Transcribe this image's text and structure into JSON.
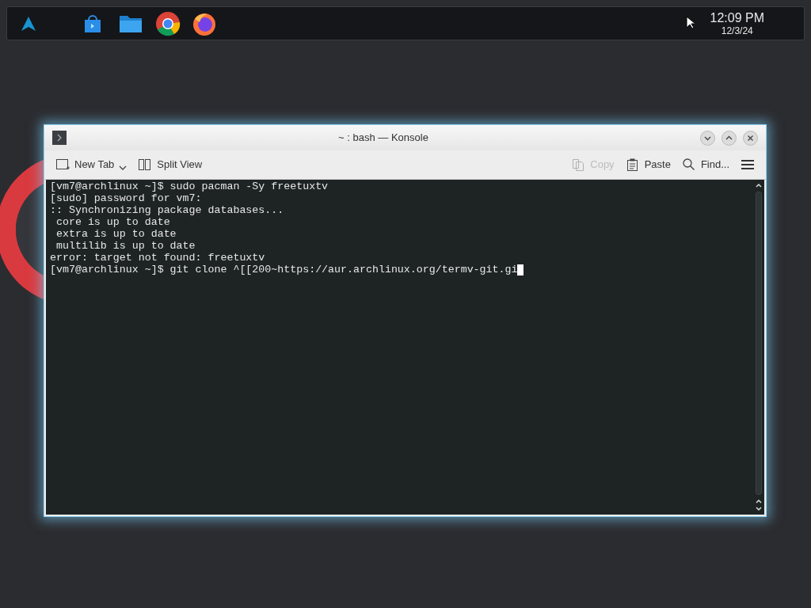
{
  "panel": {
    "clock": {
      "time": "12:09 PM",
      "date": "12/3/24"
    }
  },
  "window": {
    "title": "~ : bash — Konsole"
  },
  "toolbar": [
    {
      "kind": "new-tab",
      "label": "New Tab",
      "disabled": false
    },
    {
      "kind": "split",
      "label": "Split View",
      "disabled": false
    },
    {
      "kind": "copy",
      "label": "Copy",
      "disabled": true
    },
    {
      "kind": "paste",
      "label": "Paste",
      "disabled": false
    },
    {
      "kind": "find",
      "label": "Find...",
      "disabled": false
    },
    {
      "kind": "menu",
      "disabled": false
    }
  ],
  "terminal": {
    "lines": [
      "[vm7@archlinux ~]$ sudo pacman -Sy freetuxtv",
      "[sudo] password for vm7:",
      ":: Synchronizing package databases...",
      " core is up to date",
      " extra is up to date",
      " multilib is up to date",
      "error: target not found: freetuxtv",
      "[vm7@archlinux ~]$ git clone ^[[200~https://aur.archlinux.org/termv-git.gi"
    ]
  }
}
